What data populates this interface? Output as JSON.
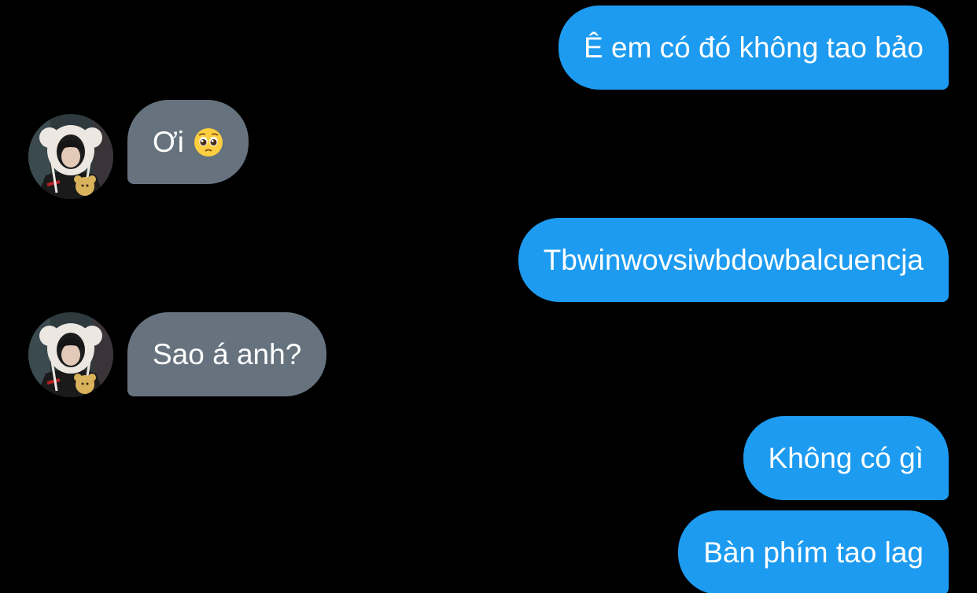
{
  "colors": {
    "background": "#000000",
    "outgoing_bubble": "#1d9bf0",
    "incoming_bubble": "#66737f",
    "text": "#ffffff"
  },
  "messages": [
    {
      "direction": "outgoing",
      "text": "Ê em có đó không tao bảo"
    },
    {
      "direction": "incoming",
      "text": "Ơi",
      "emoji": "pleading-face-emoji",
      "avatar": "contact-avatar"
    },
    {
      "direction": "outgoing",
      "text": "Tbwinwovsiwbdowbalcuencja"
    },
    {
      "direction": "incoming",
      "text": "Sao á anh?",
      "avatar": "contact-avatar"
    },
    {
      "direction": "outgoing",
      "text": "Không có gì"
    },
    {
      "direction": "outgoing",
      "text": "Bàn phím tao lag"
    }
  ]
}
